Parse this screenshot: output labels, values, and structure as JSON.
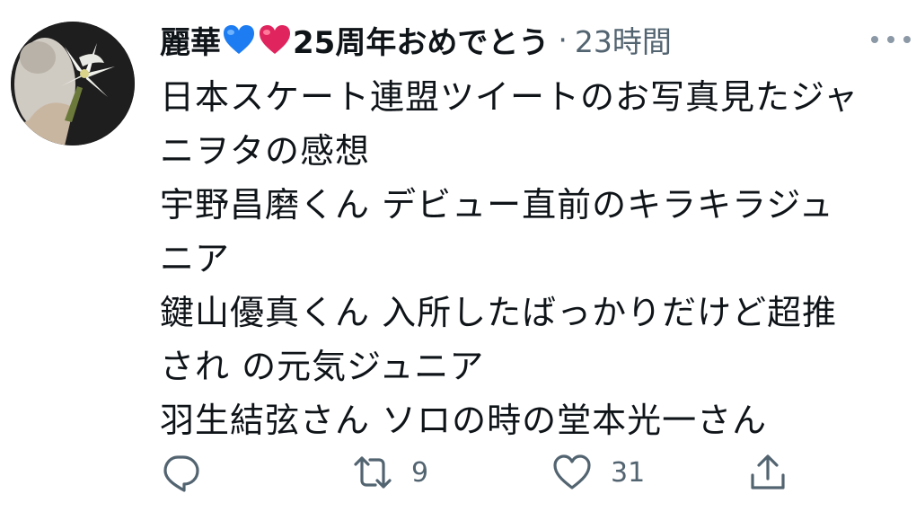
{
  "author": {
    "display_name": "麗華",
    "name_suffix": "25周年おめでとう",
    "separator": "·",
    "timestamp": "23時間",
    "avatar_icon": "lily-flower-avatar"
  },
  "tweet": {
    "lines": [
      "日本スケート連盟ツイートのお写真見たジャ",
      "ニヲタの感想",
      "宇野昌磨くん デビュー直前のキラキラジュ",
      "ニア",
      "鍵山優真くん 入所したばっかりだけど超推",
      "され の元気ジュニア",
      "羽生結弦さん ソロの時の堂本光一さん"
    ]
  },
  "actions": {
    "reply": {
      "icon": "reply-icon",
      "count": ""
    },
    "retweet": {
      "icon": "retweet-icon",
      "count": "9"
    },
    "like": {
      "icon": "heart-icon",
      "count": "31"
    },
    "share": {
      "icon": "share-icon"
    }
  },
  "colors": {
    "text": "#0f1419",
    "secondary": "#536471",
    "blue_heart": "#1d7cf2",
    "red_heart": "#e0245e"
  }
}
